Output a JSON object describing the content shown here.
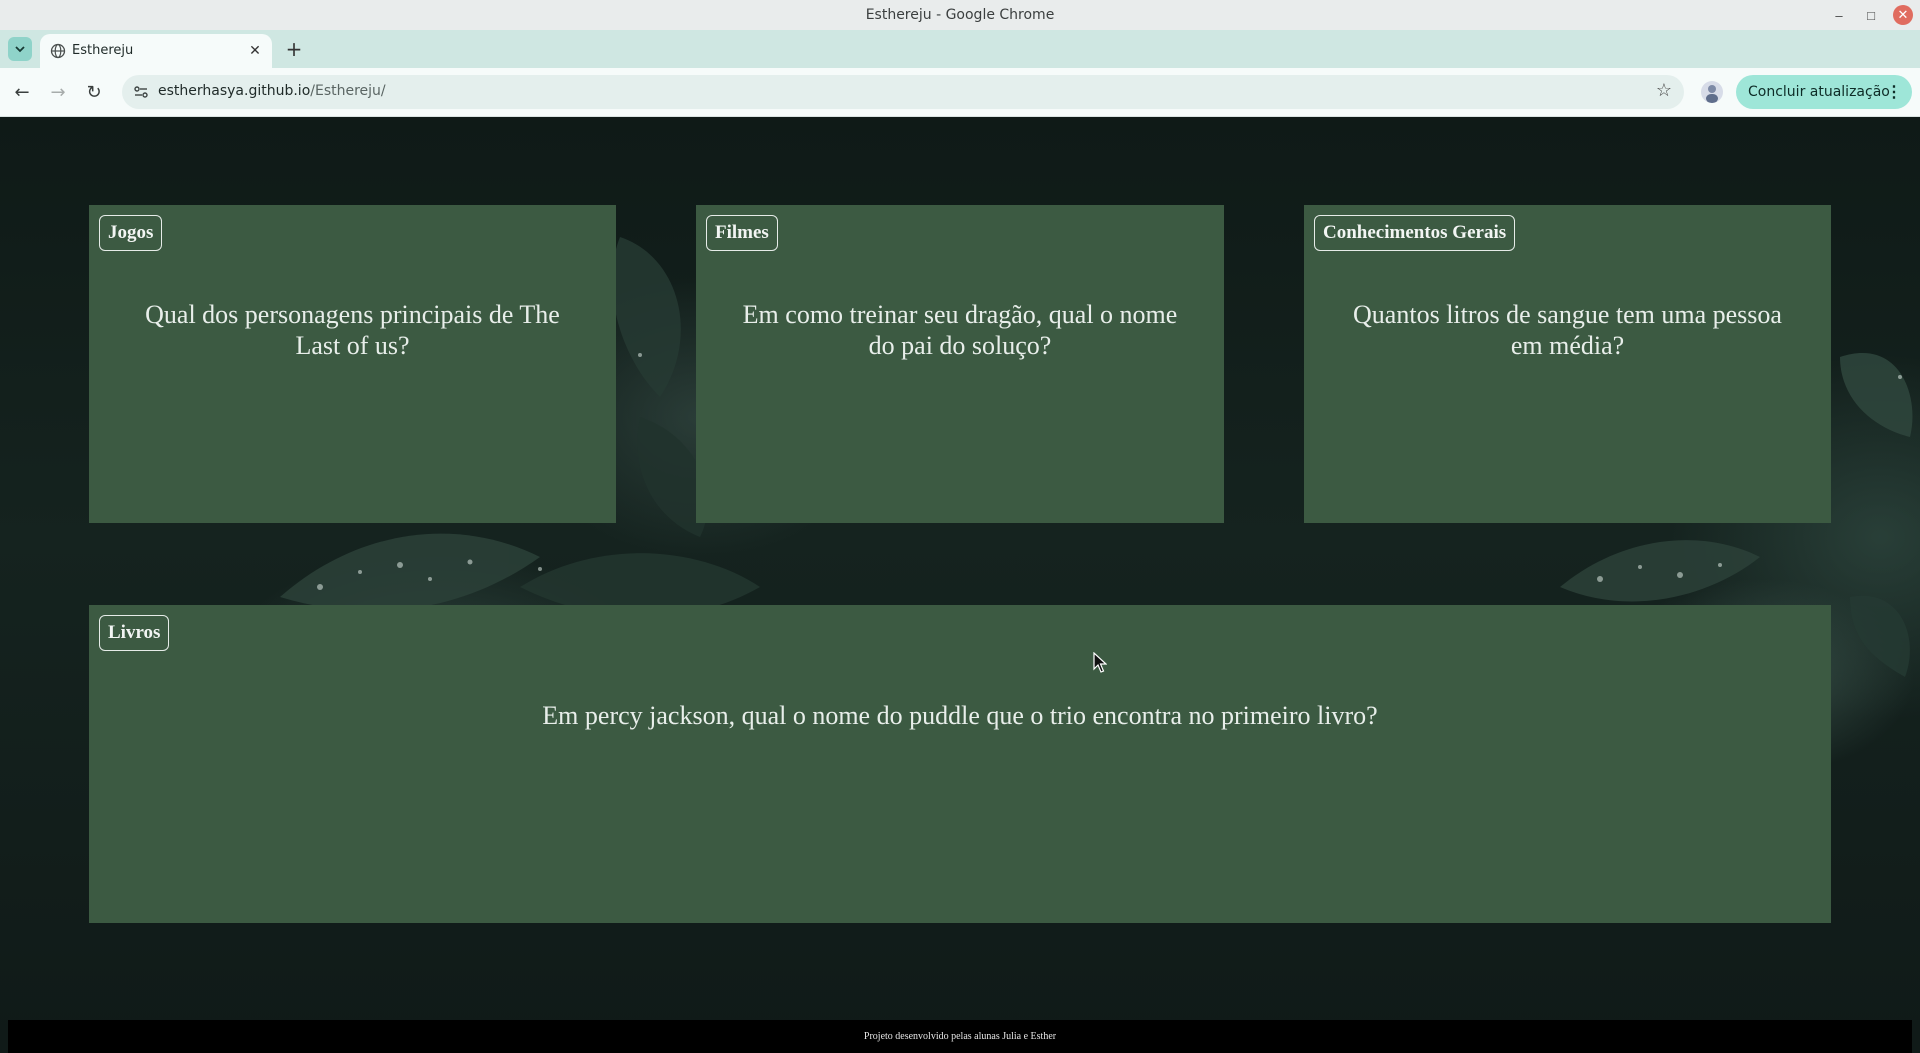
{
  "window": {
    "title": "Esthereju - Google Chrome"
  },
  "tab": {
    "title": "Esthereju"
  },
  "toolbar": {
    "url_host": "estherhasya.github.io",
    "url_path": "/Esthereju/",
    "update_label": "Concluir atualização"
  },
  "cards": [
    {
      "category": "Jogos",
      "question": "Qual dos personagens principais de The Last of us?"
    },
    {
      "category": "Filmes",
      "question": "Em como treinar seu dragão, qual o nome do pai do soluço?"
    },
    {
      "category": "Conhecimentos Gerais",
      "question": "Quantos litros de sangue tem uma pessoa em média?"
    },
    {
      "category": "Livros",
      "question": "Em percy jackson, qual o nome do puddle que o trio encontra no primeiro livro?"
    }
  ],
  "footer": {
    "text": "Projeto desenvolvido pelas alunas Julia e Esther"
  },
  "colors": {
    "card": "#3c5a42",
    "tab_strip": "#cfe7e2",
    "update_button": "#9ee6d8"
  }
}
